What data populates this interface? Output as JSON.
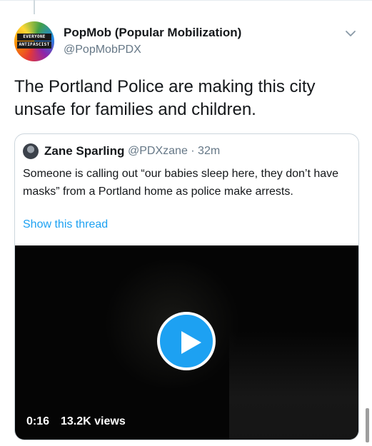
{
  "tweet": {
    "author_name": "PopMob (Popular Mobilization)",
    "author_handle": "@PopMobPDX",
    "avatar_band_top": "EVERYONE",
    "avatar_band_bottom": "ANTIFASCIST",
    "text": "The Portland Police are making this city unsafe for families and children."
  },
  "quoted_tweet": {
    "author_name": "Zane Sparling",
    "author_handle_time": "@PDXzane · 32m",
    "text": "Someone is calling out “our babies sleep here, they don’t have masks” from a Portland home as police make arrests.",
    "show_thread_label": "Show this thread",
    "video": {
      "duration": "0:16",
      "views": "13.2K views"
    }
  },
  "icons": {
    "menu": "chevron-down-icon",
    "play": "play-icon"
  },
  "colors": {
    "link_blue": "#1da1f2",
    "secondary_text": "#657786",
    "border": "#ccd6dd"
  }
}
